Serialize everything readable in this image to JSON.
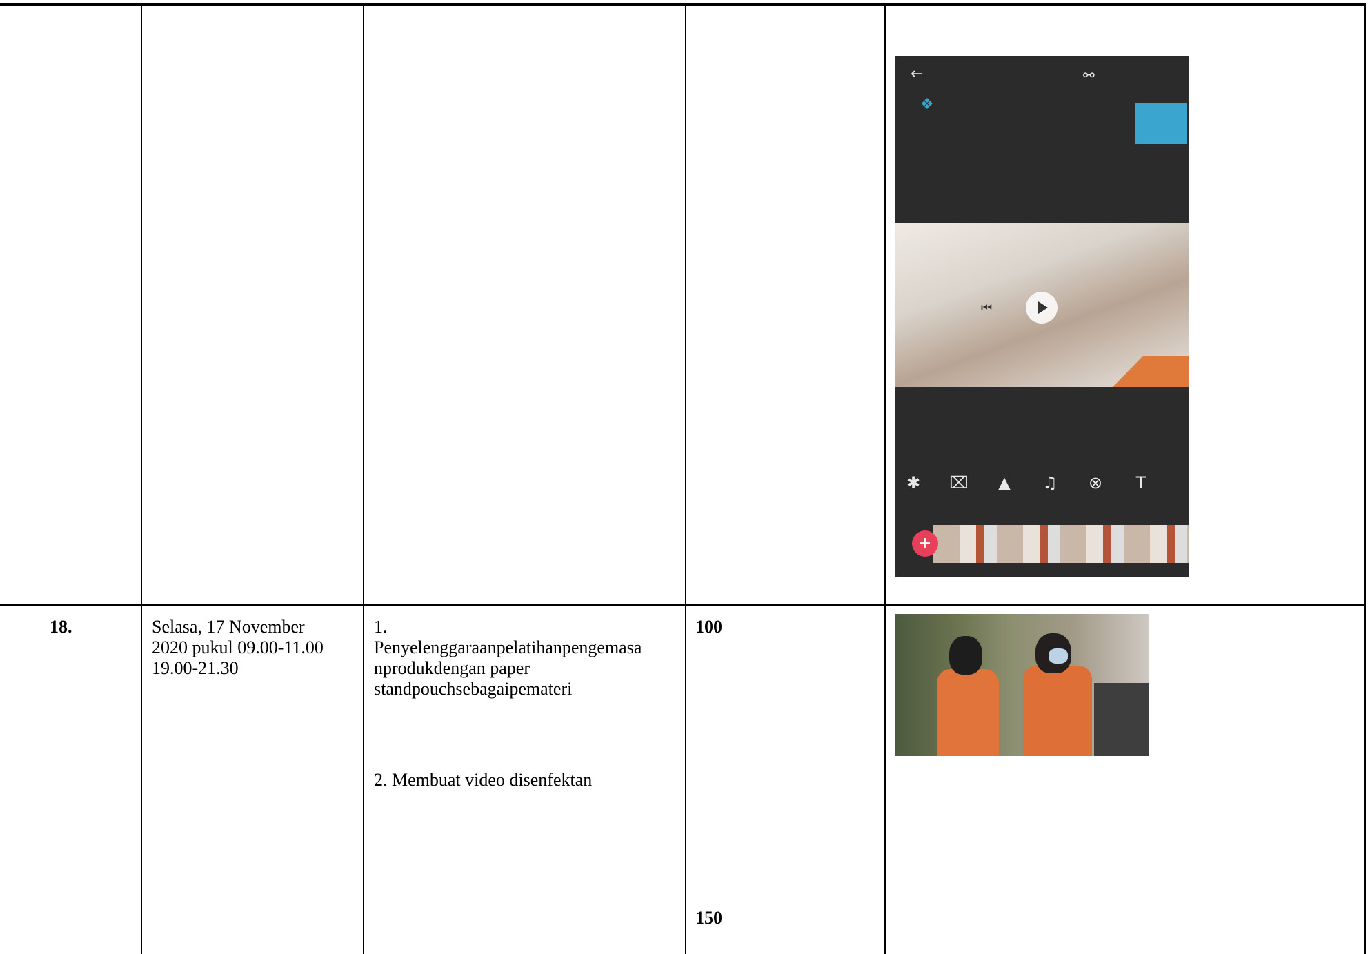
{
  "rows": [
    {
      "no": "",
      "date_lines": [],
      "activities": [],
      "hours": [],
      "attachment": "video-editor-screenshot"
    },
    {
      "no": "18.",
      "date_lines": [
        "Selasa, 17 November",
        "2020 pukul 09.00-11.00",
        "19.00-21.30"
      ],
      "activities": [
        {
          "lines": [
            "1.",
            "Penyelenggaraanpelatihanpengemasa",
            "nprodukdengan paper",
            "standpouchsebagaipemateri"
          ]
        },
        {
          "lines": [
            "2. Membuat video disenfektan"
          ]
        }
      ],
      "hours": [
        "100",
        "150"
      ],
      "attachment": "training-photo"
    }
  ],
  "icons": {
    "back": "arrow-left-icon",
    "export_menu": "export-icon",
    "play": "play-icon",
    "previous": "skip-back-icon",
    "add_clip": "plus-icon"
  }
}
